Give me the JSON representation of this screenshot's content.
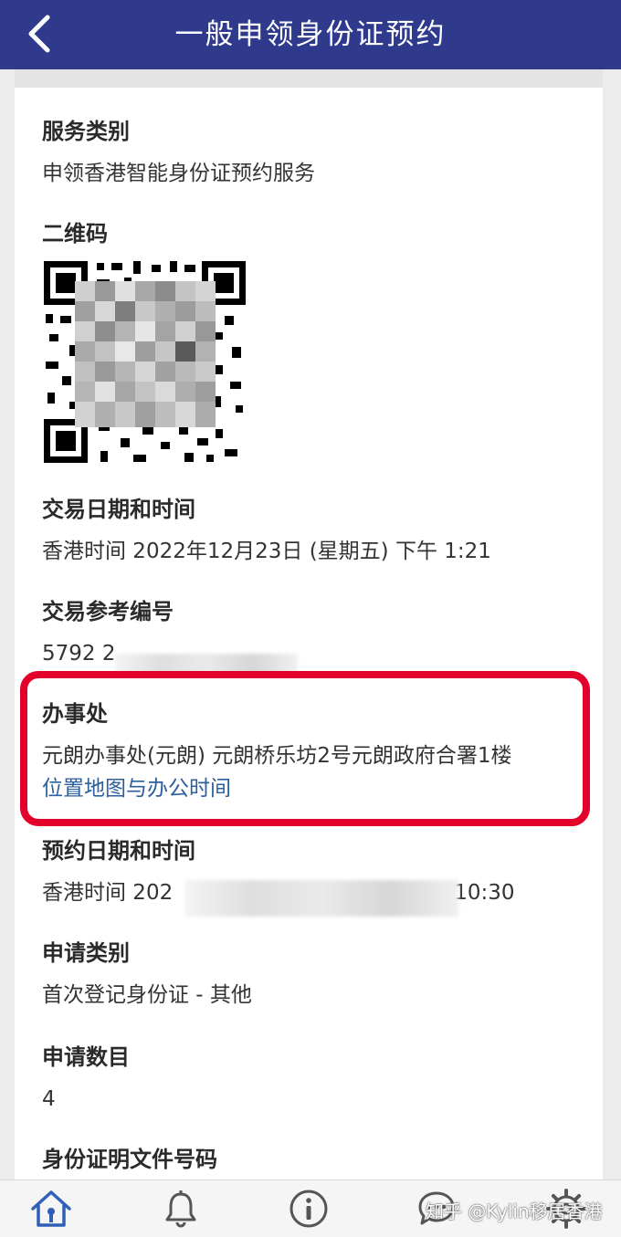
{
  "header": {
    "title": "一般申领身份证预约"
  },
  "fields": {
    "service_type": {
      "label": "服务类别",
      "value": "申领香港智能身份证预约服务"
    },
    "qr_code": {
      "label": "二维码"
    },
    "transaction_datetime": {
      "label": "交易日期和时间",
      "value": "香港时间 2022年12月23日 (星期五) 下午 1:21"
    },
    "reference_no": {
      "label": "交易参考编号",
      "value": "5792 2"
    },
    "office": {
      "label": "办事处",
      "value": "元朗办事处(元朗) 元朗桥乐坊2号元朗政府合署1楼",
      "link": "位置地图与办公时间"
    },
    "appointment_datetime": {
      "label": "预约日期和时间",
      "value_prefix": "香港时间 202",
      "value_suffix": "10:30"
    },
    "application_type": {
      "label": "申请类别",
      "value": "首次登记身份证 - 其他"
    },
    "application_count": {
      "label": "申请数目",
      "value": "4"
    },
    "id_doc_no": {
      "label": "身份证明文件号码"
    }
  },
  "bottom_nav": {
    "items": [
      "home-icon",
      "bell-icon",
      "info-icon",
      "chat-icon",
      "settings-icon"
    ]
  },
  "watermark": "知乎 @Kylin移居香港",
  "colors": {
    "header": "#2f3a8c",
    "highlight": "#e3002b",
    "link": "#2c5f9e"
  }
}
